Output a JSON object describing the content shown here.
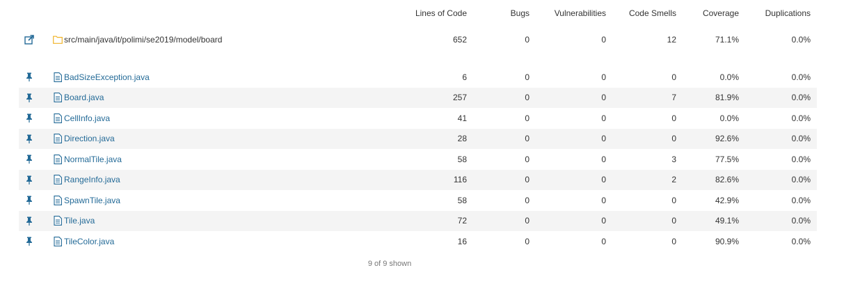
{
  "columns": {
    "loc": "Lines of Code",
    "bugs": "Bugs",
    "vulnerabilities": "Vulnerabilities",
    "code_smells": "Code Smells",
    "coverage": "Coverage",
    "duplications": "Duplications"
  },
  "directory": {
    "name": "src/main/java/it/polimi/se2019/model/board",
    "loc": "652",
    "bugs": "0",
    "vulnerabilities": "0",
    "code_smells": "12",
    "coverage": "71.1%",
    "duplications": "0.0%"
  },
  "files": [
    {
      "name": "BadSizeException.java",
      "loc": "6",
      "bugs": "0",
      "vulnerabilities": "0",
      "code_smells": "0",
      "coverage": "0.0%",
      "duplications": "0.0%"
    },
    {
      "name": "Board.java",
      "loc": "257",
      "bugs": "0",
      "vulnerabilities": "0",
      "code_smells": "7",
      "coverage": "81.9%",
      "duplications": "0.0%"
    },
    {
      "name": "CellInfo.java",
      "loc": "41",
      "bugs": "0",
      "vulnerabilities": "0",
      "code_smells": "0",
      "coverage": "0.0%",
      "duplications": "0.0%"
    },
    {
      "name": "Direction.java",
      "loc": "28",
      "bugs": "0",
      "vulnerabilities": "0",
      "code_smells": "0",
      "coverage": "92.6%",
      "duplications": "0.0%"
    },
    {
      "name": "NormalTile.java",
      "loc": "58",
      "bugs": "0",
      "vulnerabilities": "0",
      "code_smells": "3",
      "coverage": "77.5%",
      "duplications": "0.0%"
    },
    {
      "name": "RangeInfo.java",
      "loc": "116",
      "bugs": "0",
      "vulnerabilities": "0",
      "code_smells": "2",
      "coverage": "82.6%",
      "duplications": "0.0%"
    },
    {
      "name": "SpawnTile.java",
      "loc": "58",
      "bugs": "0",
      "vulnerabilities": "0",
      "code_smells": "0",
      "coverage": "42.9%",
      "duplications": "0.0%"
    },
    {
      "name": "Tile.java",
      "loc": "72",
      "bugs": "0",
      "vulnerabilities": "0",
      "code_smells": "0",
      "coverage": "49.1%",
      "duplications": "0.0%"
    },
    {
      "name": "TileColor.java",
      "loc": "16",
      "bugs": "0",
      "vulnerabilities": "0",
      "code_smells": "0",
      "coverage": "90.9%",
      "duplications": "0.0%"
    }
  ],
  "footer": {
    "shown": "9 of 9 shown"
  },
  "icons": {
    "open": "open-in-new-window-icon",
    "folder": "folder-icon",
    "pin": "pin-icon",
    "file": "file-icon"
  },
  "colors": {
    "link": "#236a97",
    "folder": "#f0b429",
    "stripe": "#f4f4f4"
  }
}
